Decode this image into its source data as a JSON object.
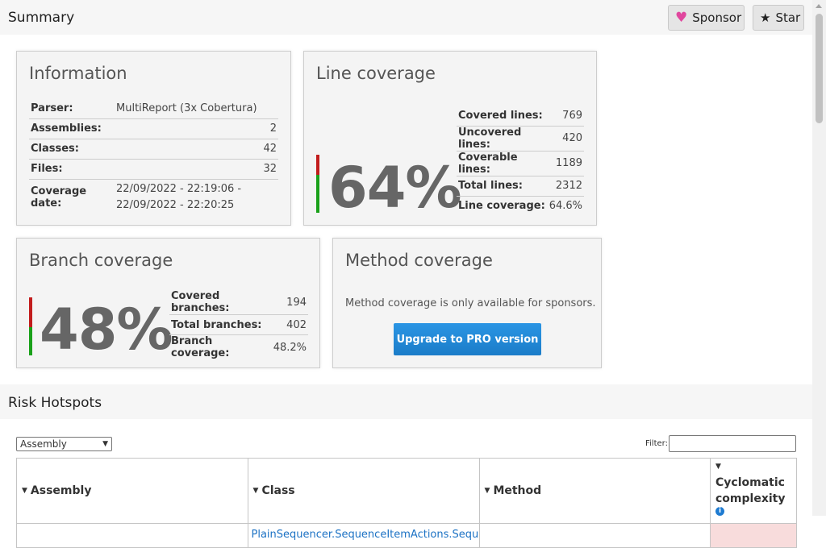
{
  "summary": {
    "title": "Summary"
  },
  "header_buttons": {
    "sponsor": "Sponsor",
    "star": "Star"
  },
  "information": {
    "title": "Information",
    "rows": [
      {
        "key": "Parser:",
        "value": "MultiReport (3x Cobertura)"
      },
      {
        "key": "Assemblies:",
        "value": "2"
      },
      {
        "key": "Classes:",
        "value": "42"
      },
      {
        "key": "Files:",
        "value": "32"
      },
      {
        "key": "Coverage date:",
        "value": "22/09/2022 - 22:19:06 - 22/09/2022 - 22:20:25"
      }
    ]
  },
  "line_coverage": {
    "title": "Line coverage",
    "percent": "64%",
    "fraction": 0.646,
    "rows": [
      {
        "key": "Covered lines:",
        "value": "769"
      },
      {
        "key": "Uncovered lines:",
        "value": "420"
      },
      {
        "key": "Coverable lines:",
        "value": "1189"
      },
      {
        "key": "Total lines:",
        "value": "2312"
      },
      {
        "key": "Line coverage:",
        "value": "64.6%"
      }
    ]
  },
  "branch_coverage": {
    "title": "Branch coverage",
    "percent": "48%",
    "fraction": 0.482,
    "rows": [
      {
        "key": "Covered branches:",
        "value": "194"
      },
      {
        "key": "Total branches:",
        "value": "402"
      },
      {
        "key": "Branch coverage:",
        "value": "48.2%"
      }
    ]
  },
  "method_coverage": {
    "title": "Method coverage",
    "message": "Method coverage is only available for sponsors.",
    "upgrade_label": "Upgrade to PRO version"
  },
  "risk_hotspots": {
    "title": "Risk Hotspots",
    "grouping_select": "Assembly",
    "filter_label": "Filter:",
    "filter_value": "",
    "columns": [
      "Assembly",
      "Class",
      "Method",
      "Cyclomatic complexity"
    ],
    "first_row": {
      "class": "PlainSequencer.SequenceItemActions.Sequ"
    }
  },
  "colors": {
    "covered": "#1aa11a",
    "uncovered": "#c21d1d",
    "upgrade": "#1e87d6",
    "heart": "#e0479e"
  }
}
